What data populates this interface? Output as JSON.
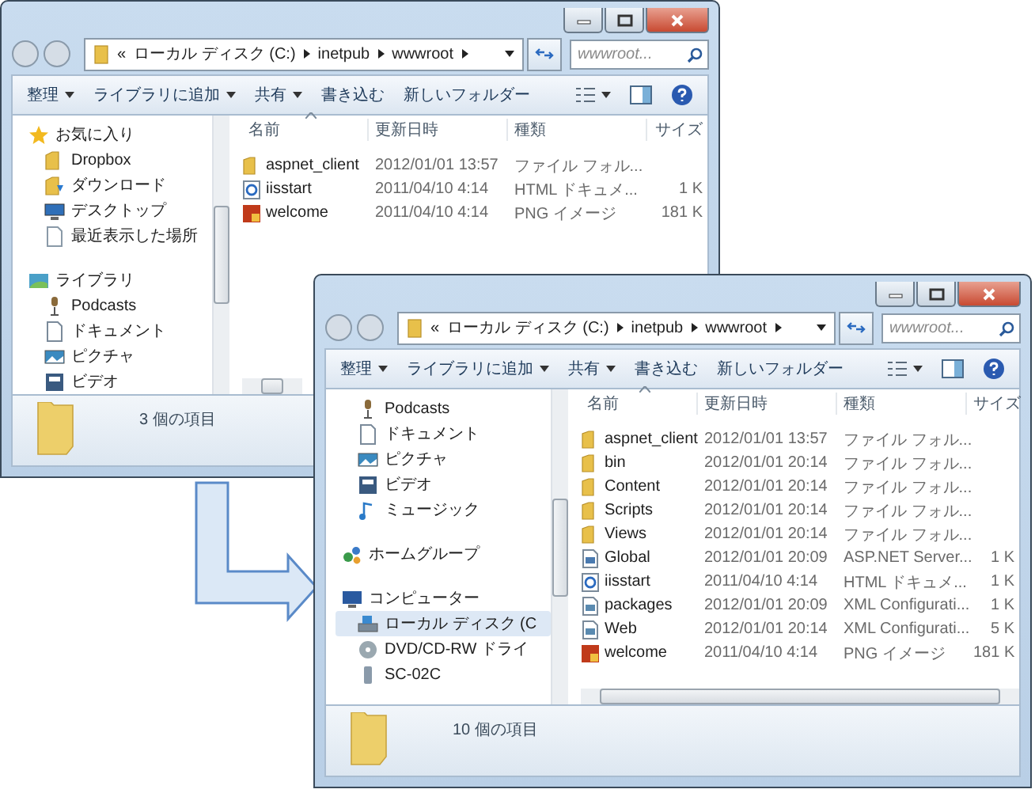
{
  "windows": [
    {
      "address": {
        "overflow": "«",
        "crumbs": [
          "ローカル ディスク (C:)",
          "inetpub",
          "wwwroot"
        ]
      },
      "search": {
        "placeholder": "wwwroot..."
      },
      "toolbar": [
        {
          "label": "整理",
          "dropdown": true
        },
        {
          "label": "ライブラリに追加",
          "dropdown": true
        },
        {
          "label": "共有",
          "dropdown": true
        },
        {
          "label": "書き込む",
          "dropdown": false
        },
        {
          "label": "新しいフォルダー",
          "dropdown": false
        }
      ],
      "sidebar": {
        "items": [
          {
            "label": "お気に入り",
            "kind": "star",
            "selected": false,
            "children": [
              {
                "label": "Dropbox",
                "kind": "folder",
                "selected": false
              },
              {
                "label": "ダウンロード",
                "kind": "download",
                "selected": false
              },
              {
                "label": "デスクトップ",
                "kind": "desktop",
                "selected": false
              },
              {
                "label": "最近表示した場所",
                "kind": "recent",
                "selected": false
              }
            ]
          },
          {
            "label": "ライブラリ",
            "kind": "library",
            "selected": false,
            "children": [
              {
                "label": "Podcasts",
                "kind": "podcast",
                "selected": false
              },
              {
                "label": "ドキュメント",
                "kind": "document",
                "selected": false
              },
              {
                "label": "ピクチャ",
                "kind": "picture",
                "selected": false
              },
              {
                "label": "ビデオ",
                "kind": "video",
                "selected": false
              }
            ]
          }
        ]
      },
      "columns": [
        {
          "label": "名前",
          "sorted": true
        },
        {
          "label": "更新日時",
          "sorted": false
        },
        {
          "label": "種類",
          "sorted": false
        },
        {
          "label": "サイズ",
          "sorted": false
        }
      ],
      "files": [
        {
          "name": "aspnet_client",
          "date": "2012/01/01 13:57",
          "type": "ファイル フォル...",
          "kind": "folder"
        },
        {
          "name": "iisstart",
          "date": "2011/04/10 4:14",
          "type": "HTML ドキュメ...",
          "size": "1 K",
          "kind": "html"
        },
        {
          "name": "welcome",
          "date": "2011/04/10 4:14",
          "type": "PNG イメージ",
          "size": "181 K",
          "kind": "png"
        }
      ],
      "status": "3 個の項目"
    },
    {
      "address": {
        "overflow": "«",
        "crumbs": [
          "ローカル ディスク (C:)",
          "inetpub",
          "wwwroot"
        ]
      },
      "search": {
        "placeholder": "wwwroot..."
      },
      "toolbar": [
        {
          "label": "整理",
          "dropdown": true
        },
        {
          "label": "ライブラリに追加",
          "dropdown": true
        },
        {
          "label": "共有",
          "dropdown": true
        },
        {
          "label": "書き込む",
          "dropdown": false
        },
        {
          "label": "新しいフォルダー",
          "dropdown": false
        }
      ],
      "sidebar": {
        "items": [
          {
            "children": [
              {
                "label": "Podcasts",
                "kind": "podcast",
                "selected": false
              },
              {
                "label": "ドキュメント",
                "kind": "document",
                "selected": false
              },
              {
                "label": "ピクチャ",
                "kind": "picture",
                "selected": false
              },
              {
                "label": "ビデオ",
                "kind": "video",
                "selected": false
              },
              {
                "label": "ミュージック",
                "kind": "music",
                "selected": false
              }
            ]
          },
          {
            "label": "ホームグループ",
            "kind": "homegroup",
            "selected": false
          },
          {
            "label": "コンピューター",
            "kind": "computer",
            "selected": false,
            "children": [
              {
                "label": "ローカル ディスク (C",
                "kind": "drive",
                "selected": true
              },
              {
                "label": "DVD/CD-RW ドライ",
                "kind": "dvd",
                "selected": false
              },
              {
                "label": "SC-02C",
                "kind": "phone",
                "selected": false
              }
            ]
          }
        ]
      },
      "columns": [
        {
          "label": "名前",
          "sorted": true
        },
        {
          "label": "更新日時",
          "sorted": false
        },
        {
          "label": "種類",
          "sorted": false
        },
        {
          "label": "サイズ",
          "sorted": false
        }
      ],
      "files": [
        {
          "name": "aspnet_client",
          "date": "2012/01/01 13:57",
          "type": "ファイル フォル...",
          "kind": "folder"
        },
        {
          "name": "bin",
          "date": "2012/01/01 20:14",
          "type": "ファイル フォル...",
          "kind": "folder"
        },
        {
          "name": "Content",
          "date": "2012/01/01 20:14",
          "type": "ファイル フォル...",
          "kind": "folder"
        },
        {
          "name": "Scripts",
          "date": "2012/01/01 20:14",
          "type": "ファイル フォル...",
          "kind": "folder"
        },
        {
          "name": "Views",
          "date": "2012/01/01 20:14",
          "type": "ファイル フォル...",
          "kind": "folder"
        },
        {
          "name": "Global",
          "date": "2012/01/01 20:09",
          "type": "ASP.NET Server...",
          "size": "1 K",
          "kind": "aspx"
        },
        {
          "name": "iisstart",
          "date": "2011/04/10 4:14",
          "type": "HTML ドキュメ...",
          "size": "1 K",
          "kind": "html"
        },
        {
          "name": "packages",
          "date": "2012/01/01 20:09",
          "type": "XML Configurati...",
          "size": "1 K",
          "kind": "xml"
        },
        {
          "name": "Web",
          "date": "2012/01/01 20:14",
          "type": "XML Configurati...",
          "size": "5 K",
          "kind": "xml"
        },
        {
          "name": "welcome",
          "date": "2011/04/10 4:14",
          "type": "PNG イメージ",
          "size": "181 K",
          "kind": "png"
        }
      ],
      "status": "10 個の項目"
    }
  ]
}
